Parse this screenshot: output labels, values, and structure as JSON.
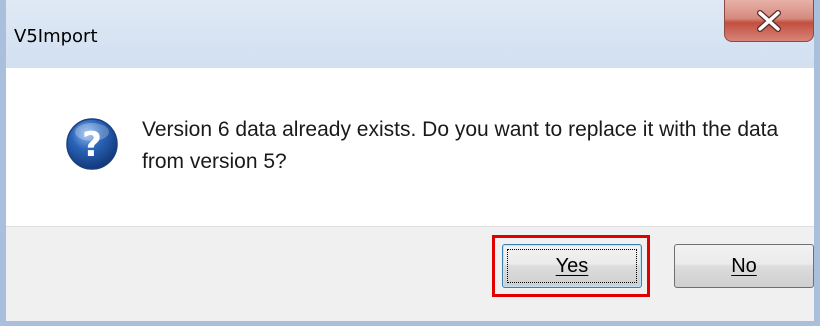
{
  "window": {
    "title": "V5Import"
  },
  "dialog": {
    "message": "Version 6 data already exists. Do you want to replace it with the data from version 5?",
    "icon": "question-icon"
  },
  "buttons": {
    "yes_label": "Yes",
    "no_label": "No"
  },
  "colors": {
    "highlight": "#e00000",
    "close_button": "#c24f3f",
    "icon_blue": "#2a63b8"
  }
}
